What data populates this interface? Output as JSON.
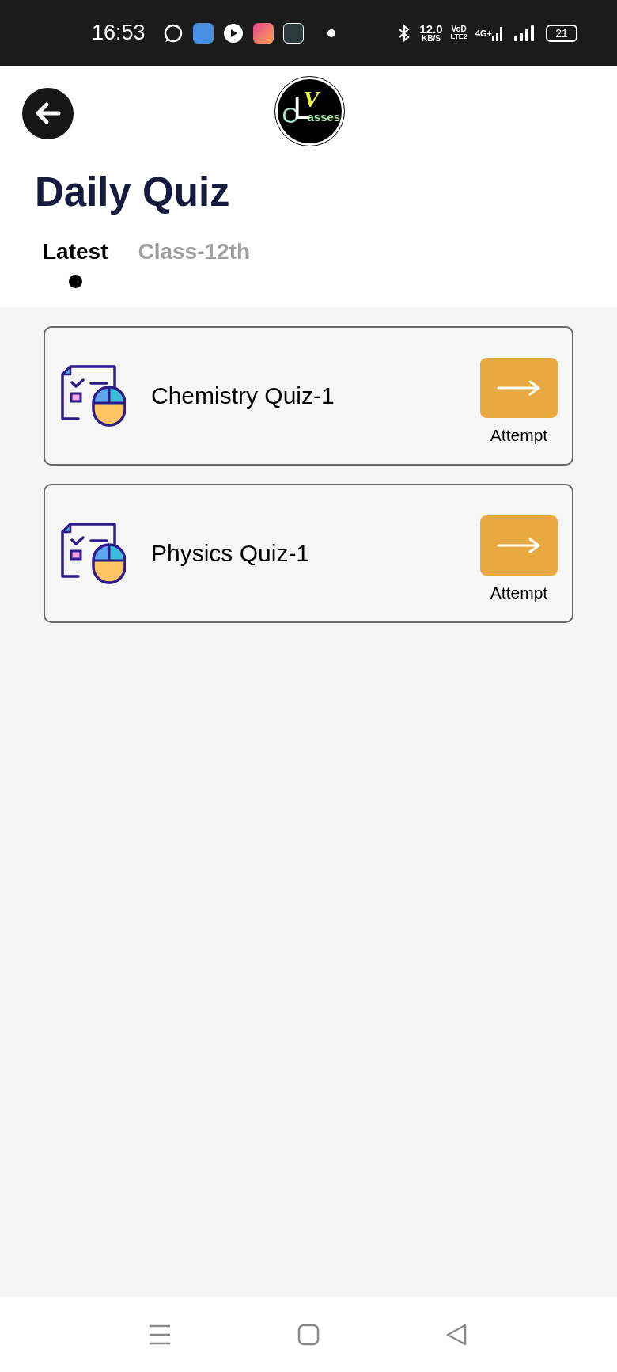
{
  "status_bar": {
    "time": "16:53",
    "speed": "12.0",
    "speed_unit": "KB/S",
    "volte_top": "VoD",
    "volte_bottom": "LTE2",
    "network": "4G+",
    "battery": "21"
  },
  "logo": {
    "v": "V",
    "c": "C",
    "l": "L",
    "rest": "asses"
  },
  "title": "Daily Quiz",
  "tabs": [
    {
      "label": "Latest",
      "selected": true
    },
    {
      "label": "Class-12th",
      "selected": false
    }
  ],
  "quizzes": [
    {
      "title": "Chemistry Quiz-1",
      "action": "Attempt"
    },
    {
      "title": "Physics Quiz-1",
      "action": "Attempt"
    }
  ]
}
